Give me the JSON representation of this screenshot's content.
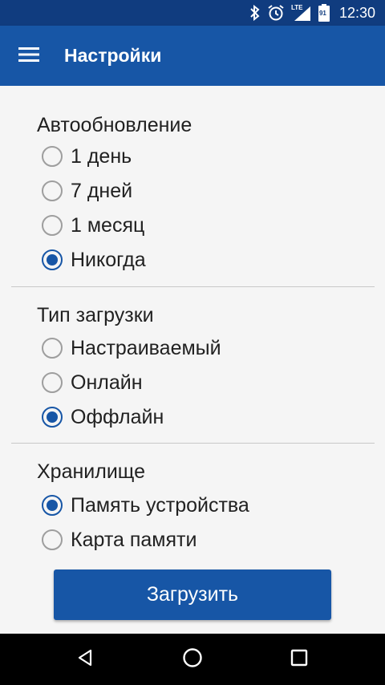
{
  "status_bar": {
    "time": "12:30",
    "network_label": "LTE",
    "battery_level": "91",
    "icons": [
      "bluetooth-icon",
      "alarm-icon",
      "lte-signal-icon",
      "battery-icon"
    ]
  },
  "app_bar": {
    "title": "Настройки",
    "menu_icon": "hamburger-menu-icon"
  },
  "sections": {
    "autoupdate": {
      "title": "Автообновление",
      "options": [
        "1 день",
        "7 дней",
        "1 месяц",
        "Никогда"
      ],
      "selected": "Никогда"
    },
    "download_type": {
      "title": "Тип загрузки",
      "options": [
        "Настраиваемый",
        "Онлайн",
        "Оффлайн"
      ],
      "selected": "Оффлайн"
    },
    "storage": {
      "title": "Хранилище",
      "options": [
        "Память устройства",
        "Карта памяти"
      ],
      "selected": "Память устройства"
    }
  },
  "download_button": {
    "label": "Загрузить"
  },
  "nav_bar": {
    "icons": [
      "back-icon",
      "home-icon",
      "recents-icon"
    ]
  },
  "colors": {
    "status_bar": "#103c7f",
    "primary": "#1756a6",
    "background": "#f5f5f5",
    "text": "#212121",
    "radio_unchecked": "#9e9e9e"
  }
}
